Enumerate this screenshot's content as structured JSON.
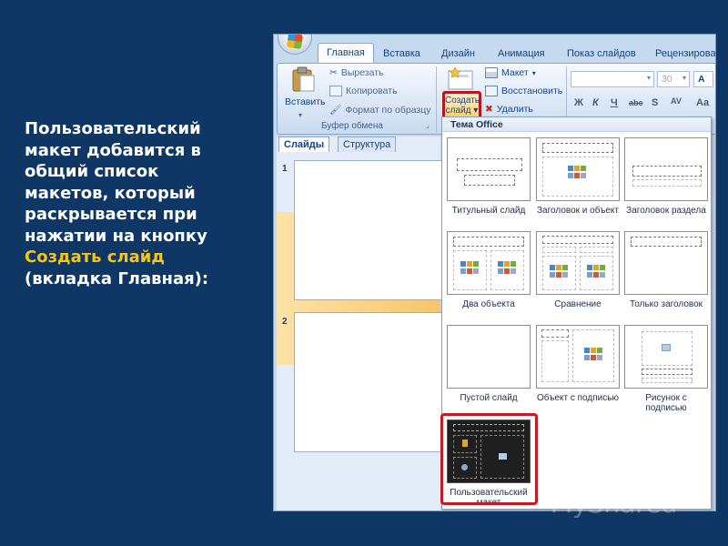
{
  "caption": {
    "line1": "Пользовательский",
    "line2": "макет добавится в",
    "line3": "общий список",
    "line4": "макетов, который",
    "line5": "раскрывается при",
    "line6": "нажатии на кнопку",
    "highlight": "Создать слайд",
    "line8": "(вкладка Главная):"
  },
  "tabs": [
    "Главная",
    "Вставка",
    "Дизайн",
    "Анимация",
    "Показ слайдов",
    "Рецензирова"
  ],
  "clipboard": {
    "paste": "Вставить",
    "cut": "Вырезать",
    "copy": "Копировать",
    "format_painter": "Формат по образцу",
    "group_label": "Буфер обмена"
  },
  "slides_group": {
    "create_line1": "Создать",
    "create_line2": "слайд",
    "layout": "Макет",
    "reset": "Восстановить",
    "delete": "Удалить"
  },
  "font": {
    "size": "30"
  },
  "pane_tabs": {
    "slides": "Слайды",
    "outline": "Структура"
  },
  "thumbnails": [
    "1",
    "2"
  ],
  "gallery": {
    "header": "Тема Office",
    "layouts": [
      "Титульный слайд",
      "Заголовок и объект",
      "Заголовок раздела",
      "Два объекта",
      "Сравнение",
      "Только заголовок",
      "Пустой слайд",
      "Объект с подписью",
      "Рисунок с подписью",
      "Пользовательский макет"
    ]
  },
  "watermark": "MyShared",
  "colors": {
    "background": "#0f3766",
    "highlight": "#f5c51a",
    "selection": "#c11b25"
  }
}
